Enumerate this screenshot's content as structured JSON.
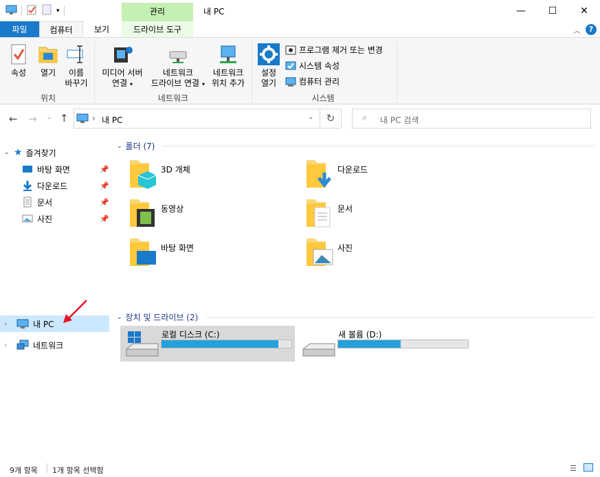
{
  "window": {
    "title": "내 PC",
    "contextual_tab_group": "관리",
    "controls": {
      "minimize": "—",
      "maximize": "☐",
      "close": "✕"
    }
  },
  "ribbon_tabs": {
    "file": "파일",
    "computer": "컴퓨터",
    "view": "보기",
    "drive_tools": "드라이브 도구"
  },
  "ribbon": {
    "location": {
      "label": "위치",
      "properties": "속성",
      "open": "열기",
      "rename_line1": "이름",
      "rename_line2": "바꾸기"
    },
    "network": {
      "label": "네트워크",
      "media_server_line1": "미디어 서버",
      "media_server_line2": "연결",
      "map_drive_line1": "네트워크",
      "map_drive_line2": "드라이브 연결",
      "add_location_line1": "네트워크",
      "add_location_line2": "위치 추가"
    },
    "system": {
      "label": "시스템",
      "settings_line1": "설정",
      "settings_line2": "열기",
      "uninstall": "프로그램 제거 또는 변경",
      "system_properties": "시스템 속성",
      "manage": "컴퓨터 관리"
    }
  },
  "address": {
    "path": "내 PC",
    "search_placeholder": "내 PC 검색"
  },
  "nav_pane": {
    "quick_access": "즐겨찾기",
    "desktop": "바탕 화면",
    "downloads": "다운로드",
    "documents": "문서",
    "pictures": "사진",
    "this_pc": "내 PC",
    "network": "네트워크"
  },
  "folders": {
    "header": "폴더 (7)",
    "items": [
      "3D 개체",
      "다운로드",
      "동영상",
      "문서",
      "바탕 화면",
      "사진"
    ]
  },
  "drives": {
    "header": "장치 및 드라이브 (2)",
    "items": [
      {
        "name": "로컬 디스크 (C:)",
        "usage": 0.9
      },
      {
        "name": "새 볼륨 (D:)",
        "usage": 0.48
      }
    ]
  },
  "status": {
    "count": "9개 항목",
    "selected": "1개 항목 선택함"
  },
  "colors": {
    "accent": "#1979ca",
    "context_tab": "#c5f0b3",
    "selection": "#cce8ff",
    "bar_fill": "#26a0da",
    "arrow": "#e81123"
  }
}
